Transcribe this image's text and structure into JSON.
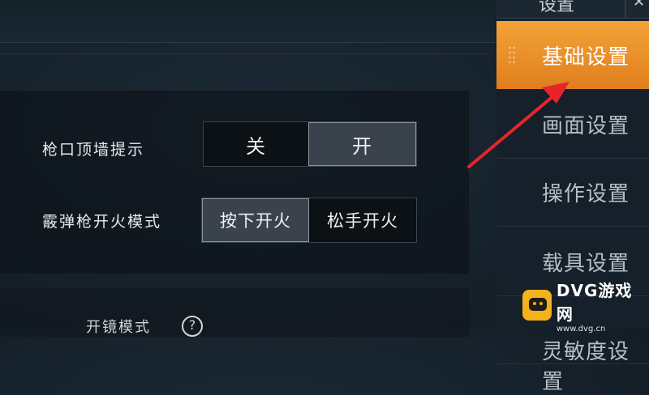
{
  "settings": {
    "muzzle_wall_hint": {
      "label": "枪口顶墙提示",
      "options": [
        "关",
        "开"
      ],
      "selected": "开"
    },
    "shotgun_fire_mode": {
      "label": "霰弹枪开火模式",
      "options": [
        "按下开火",
        "松手开火"
      ],
      "selected": "按下开火"
    },
    "scope_mode": {
      "label": "开镜模式"
    }
  },
  "sidebar": {
    "header": "设置",
    "tabs": [
      "基础设置",
      "画面设置",
      "操作设置",
      "载具设置",
      "灵敏度设置"
    ],
    "active_tab": "基础设置"
  },
  "colors": {
    "accent": "#f0952a",
    "arrow": "#e8242b"
  },
  "watermark": {
    "main": "DVG游戏网",
    "sub": "www.dvg.cn"
  }
}
